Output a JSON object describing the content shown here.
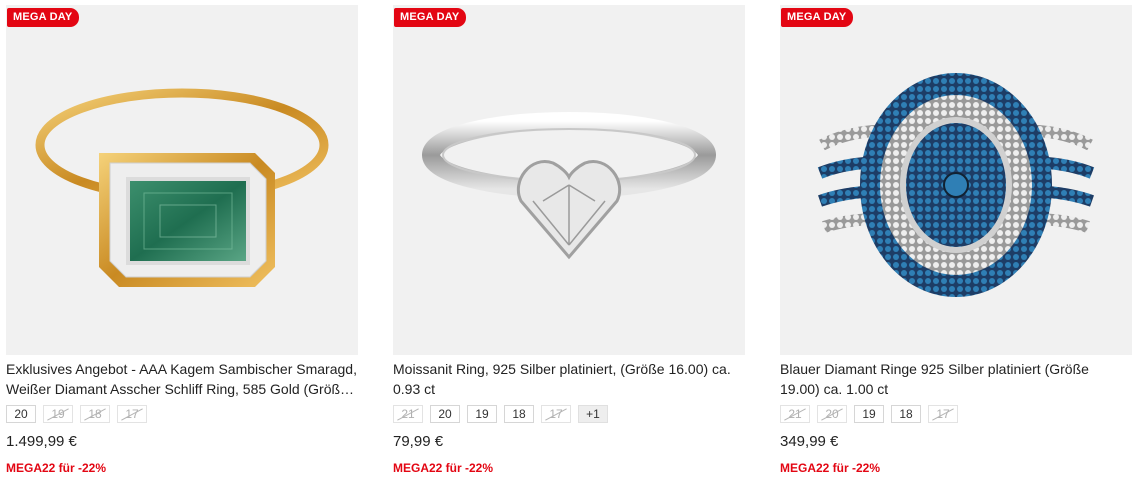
{
  "products": [
    {
      "badge": "MEGA DAY",
      "title": "Exklusives Angebot - AAA Kagem Sambischer Smaragd, Weißer Diamant Asscher Schliff Ring, 585 Gold (Größ…",
      "sizes": [
        {
          "label": "20",
          "available": true
        },
        {
          "label": "19",
          "available": false
        },
        {
          "label": "18",
          "available": false
        },
        {
          "label": "17",
          "available": false
        }
      ],
      "price": "1.499,99 €",
      "promo": "MEGA22 für -22%",
      "image": "emerald-gold-ring-image"
    },
    {
      "badge": "MEGA DAY",
      "title": "Moissanit Ring, 925 Silber platiniert, (Größe 16.00) ca. 0.93 ct",
      "sizes": [
        {
          "label": "21",
          "available": false
        },
        {
          "label": "20",
          "available": true
        },
        {
          "label": "19",
          "available": true
        },
        {
          "label": "18",
          "available": true
        },
        {
          "label": "17",
          "available": false
        },
        {
          "label": "+1",
          "available": true,
          "more": true
        }
      ],
      "price": "79,99 €",
      "promo": "MEGA22 für -22%",
      "image": "heart-moissanite-silver-ring-image"
    },
    {
      "badge": "MEGA DAY",
      "title": "Blauer Diamant Ringe 925 Silber platiniert (Größe 19.00) ca. 1.00 ct",
      "sizes": [
        {
          "label": "21",
          "available": false
        },
        {
          "label": "20",
          "available": false
        },
        {
          "label": "19",
          "available": true
        },
        {
          "label": "18",
          "available": true
        },
        {
          "label": "17",
          "available": false
        }
      ],
      "price": "349,99 €",
      "promo": "MEGA22 für -22%",
      "image": "blue-diamond-cluster-ring-image"
    }
  ],
  "colors": {
    "badge": "#e30613",
    "promo": "#e30613",
    "image_bg": "#f1f1f1"
  }
}
